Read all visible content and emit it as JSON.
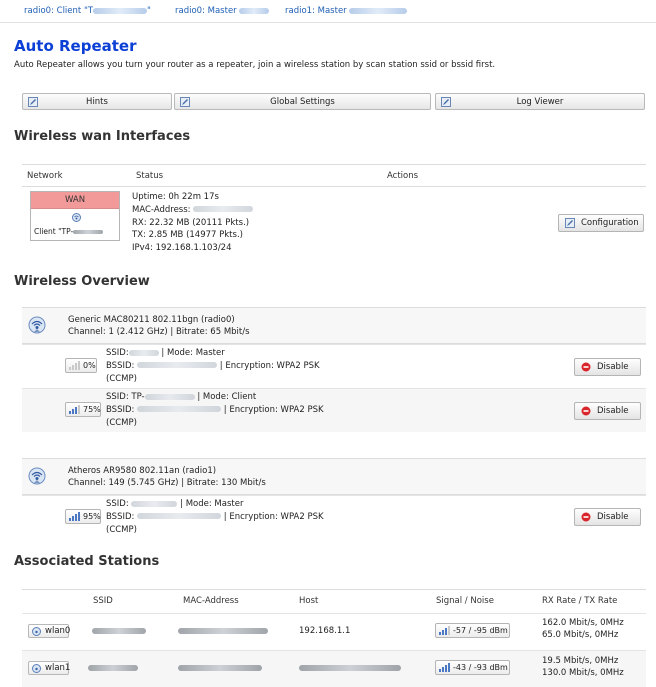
{
  "topbar": {
    "items": [
      {
        "label": "radio0: Client \"T"
      },
      {
        "label": "radio0: Master"
      },
      {
        "label": "radio1: Master"
      }
    ]
  },
  "page": {
    "title": "Auto Repeater",
    "description": "Auto Repeater allows you turn your router as a repeater, join a wireless station by scan station ssid or bssid first."
  },
  "toolbar": {
    "hints": "Hints",
    "global_settings": "Global Settings",
    "log_viewer": "Log Viewer"
  },
  "wan_section": {
    "title": "Wireless wan Interfaces",
    "headers": {
      "network": "Network",
      "status": "Status",
      "actions": "Actions"
    },
    "wan_label": "WAN",
    "wan_client": "Client \"TP-",
    "status_lines": {
      "uptime": "Uptime: 0h 22m 17s",
      "mac": "MAC-Address:",
      "rx": "RX: 22.32 MB (20111 Pkts.)",
      "tx": "TX: 2.85 MB (14977 Pkts.)",
      "ipv4": "IPv4: 192.168.1.103/24"
    },
    "config_button": "Configuration"
  },
  "overview": {
    "title": "Wireless Overview",
    "radios": [
      {
        "name": "Generic MAC80211 802.11bgn (radio0)",
        "info": "Channel: 1 (2.412 GHz) | Bitrate: 65 Mbit/s",
        "networks": [
          {
            "signal": "0%",
            "l1_prefix": "SSID:",
            "l1_suffix": "| Mode: Master",
            "l2_prefix": "BSSID:",
            "l2_suffix": "| Encryption: WPA2 PSK",
            "l3": "(CCMP)",
            "button": "Disable"
          },
          {
            "signal": "75%",
            "l1_prefix": "SSID: TP-",
            "l1_suffix": "| Mode: Client",
            "l2_prefix": "BSSID:",
            "l2_suffix": "| Encryption: WPA2 PSK",
            "l3": "(CCMP)",
            "button": "Disable"
          }
        ]
      },
      {
        "name": "Atheros AR9580 802.11an (radio1)",
        "info": "Channel: 149 (5.745 GHz) | Bitrate: 130 Mbit/s",
        "networks": [
          {
            "signal": "95%",
            "l1_prefix": "SSID:",
            "l1_suffix": "| Mode: Master",
            "l2_prefix": "BSSID:",
            "l2_suffix": "| Encryption: WPA2 PSK",
            "l3": "(CCMP)",
            "button": "Disable"
          }
        ]
      }
    ]
  },
  "stations": {
    "title": "Associated Stations",
    "headers": {
      "ssid": "SSID",
      "mac": "MAC-Address",
      "host": "Host",
      "signal": "Signal / Noise",
      "rate": "RX Rate / TX Rate"
    },
    "rows": [
      {
        "iface": "wlan0",
        "host": "192.168.1.1",
        "signal": "-57 / -95 dBm",
        "rx": "162.0 Mbit/s, 0MHz",
        "tx": "65.0 Mbit/s, 0MHz"
      },
      {
        "iface": "wlan1",
        "host": "",
        "signal": "-43 / -93 dBm",
        "rx": "19.5 Mbit/s, 0MHz",
        "tx": "130.0 Mbit/s, 0MHz"
      }
    ]
  },
  "colors": {
    "title": "#0b3fd6",
    "link": "#1f5fb5",
    "wan_header": "#f29a9a",
    "disable_icon": "#d9262b"
  },
  "icons": {
    "edit": "edit-icon",
    "radio": "wifi-radio-icon",
    "signal": "signal-bars-icon",
    "disable": "disable-icon"
  }
}
